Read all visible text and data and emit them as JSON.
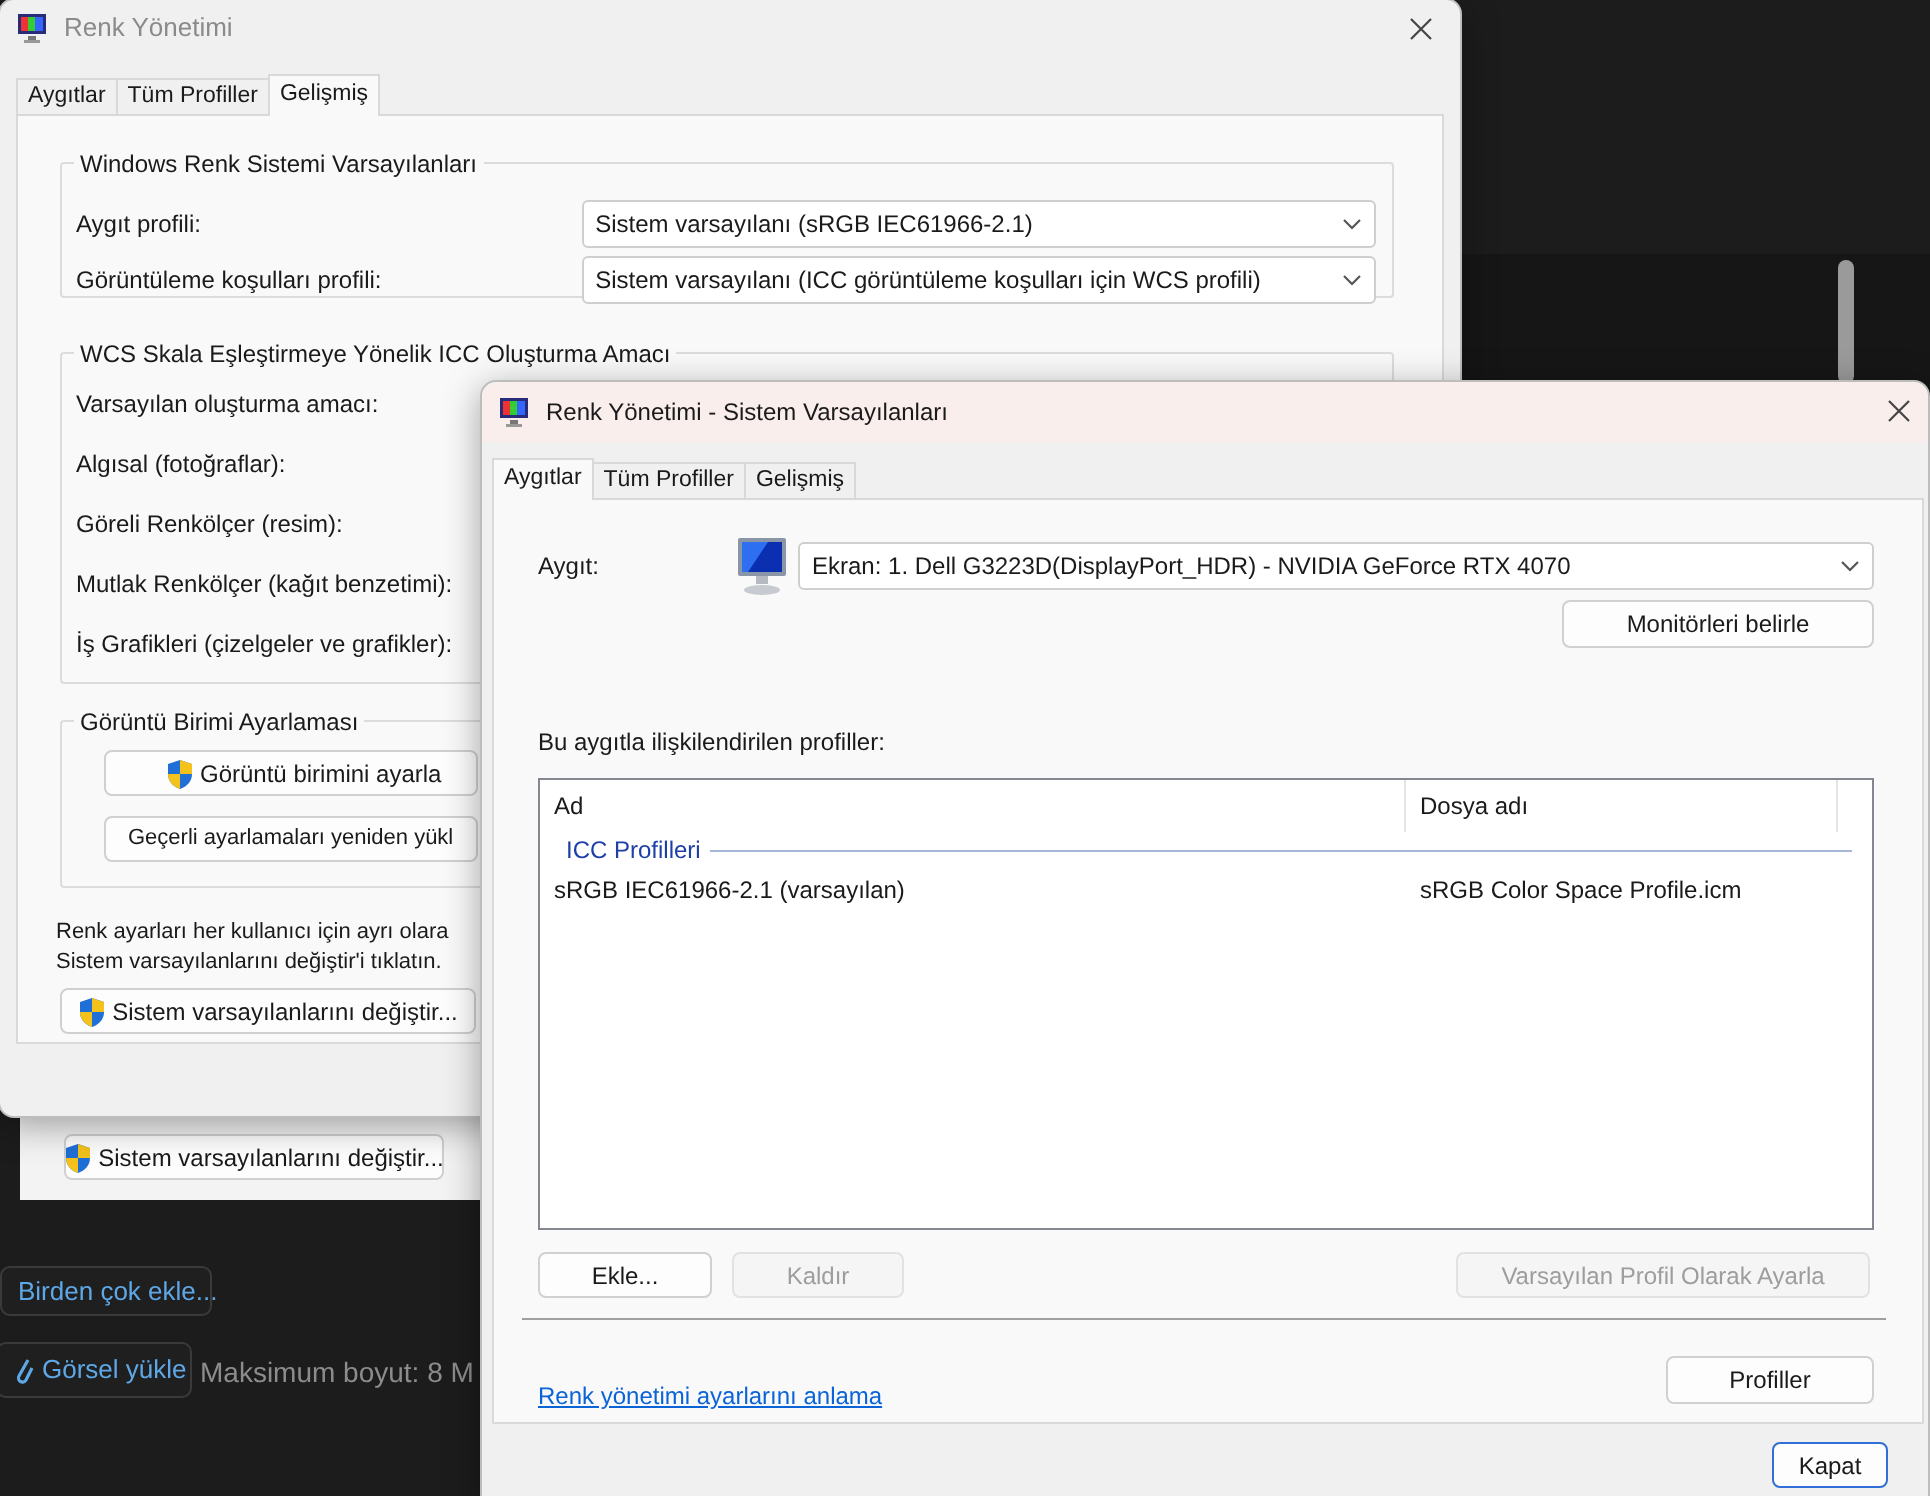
{
  "background_app": {
    "panel_button": {
      "label": "Sistem varsayılanlarını değiştir...",
      "shield": true
    },
    "add_many_button": "Birden çok ekle...",
    "upload_button": "Görsel yükle",
    "size_note": "Maksimum boyut: 8 M"
  },
  "back_window": {
    "title": "Renk Yönetimi",
    "tabs": [
      {
        "label": "Aygıtlar",
        "selected": false
      },
      {
        "label": "Tüm Profiller",
        "selected": false
      },
      {
        "label": "Gelişmiş",
        "selected": true
      }
    ],
    "defaults_group": {
      "title": "Windows Renk Sistemi Varsayılanları",
      "rows": [
        {
          "label": "Aygıt profili:",
          "value": "Sistem varsayılanı (sRGB IEC61966-2.1)"
        },
        {
          "label": "Görüntüleme koşulları profili:",
          "value": "Sistem varsayılanı (ICC görüntüleme koşulları için WCS profili)"
        }
      ]
    },
    "intent_group": {
      "title": "WCS Skala Eşleştirmeye Yönelik ICC Oluşturma Amacı",
      "labels": [
        "Varsayılan oluşturma amacı:",
        "Algısal (fotoğraflar):",
        "Göreli Renkölçer (resim):",
        "Mutlak Renkölçer (kağıt benzetimi):",
        "İş Grafikleri (çizelgeler ve grafikler):"
      ]
    },
    "calibration_group": {
      "title": "Görüntü Birimi Ayarlaması",
      "buttons": [
        {
          "label": "Görüntü birimini ayarla",
          "shield": true
        },
        {
          "label": "Geçerli ayarlamaları yeniden yükl",
          "shield": false
        }
      ]
    },
    "note_lines": [
      "Renk ayarları her kullanıcı için ayrı olara",
      "Sistem varsayılanlarını değiştir'i tıklatın."
    ],
    "change_button": {
      "label": "Sistem varsayılanlarını değiştir...",
      "shield": true
    }
  },
  "front_window": {
    "title": "Renk Yönetimi - Sistem Varsayılanları",
    "tabs": [
      {
        "label": "Aygıtlar",
        "selected": true
      },
      {
        "label": "Tüm Profiller",
        "selected": false
      },
      {
        "label": "Gelişmiş",
        "selected": false
      }
    ],
    "device": {
      "label": "Aygıt:",
      "value": "Ekran: 1. Dell G3223D(DisplayPort_HDR) - NVIDIA GeForce RTX 4070"
    },
    "identify_button": "Monitörleri belirle",
    "profiles_label": "Bu aygıtla ilişkilendirilen profiller:",
    "profile_list": {
      "columns": [
        "Ad",
        "Dosya adı"
      ],
      "groups": [
        {
          "title": "ICC Profilleri",
          "rows": [
            {
              "name": "sRGB IEC61966-2.1 (varsayılan)",
              "file": "sRGB Color Space Profile.icm",
              "selected": false
            }
          ]
        }
      ]
    },
    "list_buttons": [
      {
        "label": "Ekle...",
        "disabled": false
      },
      {
        "label": "Kaldır",
        "disabled": true
      },
      {
        "label": "Varsayılan Profil Olarak Ayarla",
        "disabled": true
      }
    ],
    "help_link": "Renk yönetimi ayarlarını anlama",
    "profiles_button": "Profiller",
    "close_button": {
      "label": "Kapat",
      "default": true
    }
  }
}
